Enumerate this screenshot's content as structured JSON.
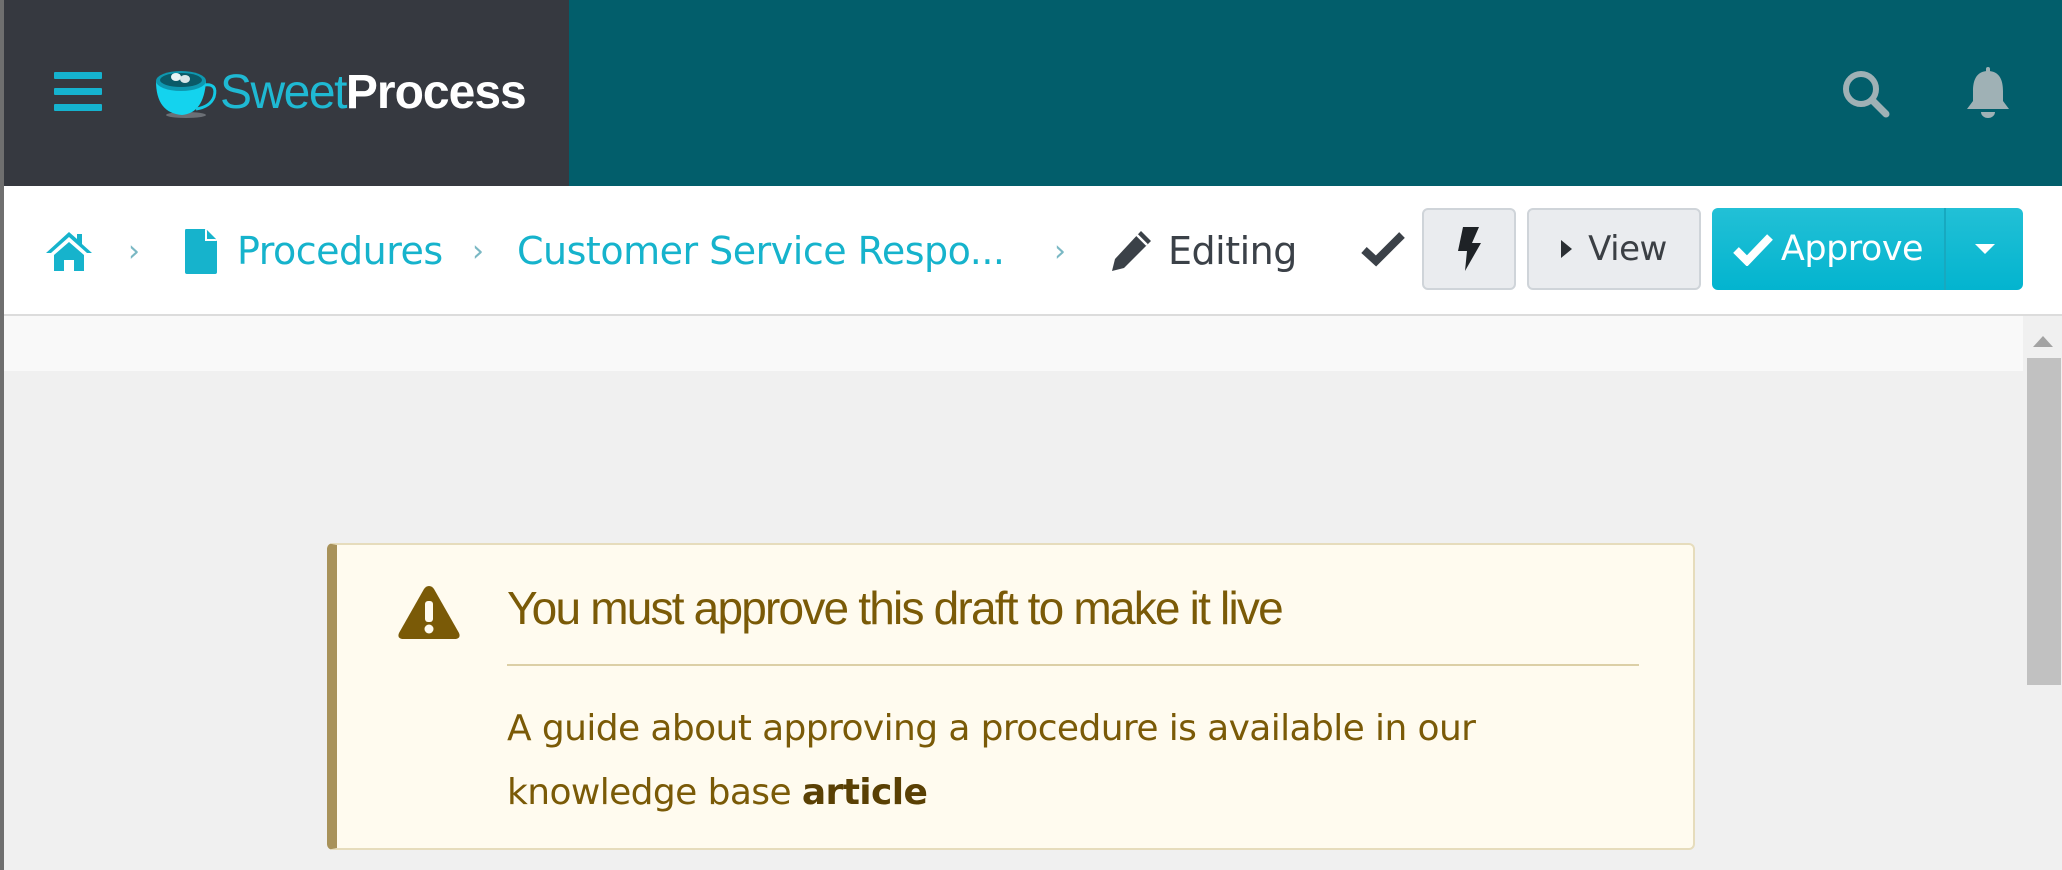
{
  "app": {
    "brand_part1": "Sweet",
    "brand_part2": "Process"
  },
  "header": {
    "menu_icon": "hamburger-menu-icon",
    "search_icon": "search-icon",
    "notifications_icon": "bell-icon"
  },
  "breadcrumb": {
    "home_icon": "home-icon",
    "items": [
      {
        "label": "Procedures",
        "icon": "document-icon"
      },
      {
        "label": "Customer Service Respo..."
      },
      {
        "label": "Editing",
        "icon": "pencil-icon"
      }
    ]
  },
  "toolbar": {
    "saved_icon": "check-icon",
    "flash_icon": "lightning-icon",
    "view_label": "View",
    "approve_label": "Approve",
    "approve_dropdown_icon": "caret-down-icon"
  },
  "alert": {
    "icon": "warning-triangle-icon",
    "heading": "You must approve this draft to make it live",
    "body_text": "A guide about approving a procedure is available in our knowledge base ",
    "link_text": "article"
  },
  "colors": {
    "header_teal": "#025e6b",
    "brand_panel": "#363940",
    "accent_cyan": "#16b3cc",
    "alert_text": "#7a5a07",
    "alert_bg": "#fffbef"
  }
}
